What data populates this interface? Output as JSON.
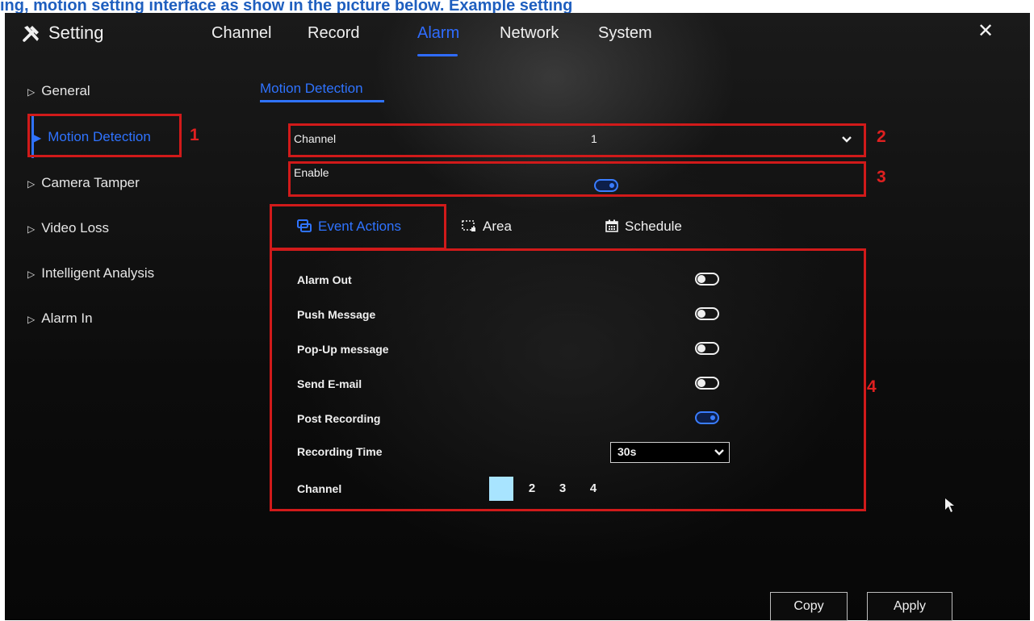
{
  "caption": {
    "part1": "ing, motion setting interface as show in the picture below. Example setting",
    "part2": "setting"
  },
  "app": {
    "title": "Setting",
    "title_icon": "tools-icon",
    "close_icon": "close-icon"
  },
  "topnav": [
    "Channel",
    "Record",
    "Alarm",
    "Network",
    "System"
  ],
  "topnav_active": "Alarm",
  "sidebar": {
    "items": [
      "General",
      "Motion Detection",
      "Camera Tamper",
      "Video Loss",
      "Intelligent Analysis",
      "Alarm In"
    ],
    "active": "Motion Detection"
  },
  "subtab": "Motion Detection",
  "channel_row": {
    "label": "Channel",
    "value": "1"
  },
  "enable_row": {
    "label": "Enable",
    "enabled": true
  },
  "tabs": [
    {
      "label": "Event Actions",
      "icon": "event-actions-icon"
    },
    {
      "label": "Area",
      "icon": "area-icon"
    },
    {
      "label": "Schedule",
      "icon": "calendar-icon"
    }
  ],
  "tabs_active": "Event Actions",
  "actions": [
    {
      "label": "Alarm Out",
      "enabled": false
    },
    {
      "label": "Push Message",
      "enabled": false
    },
    {
      "label": "Pop-Up message",
      "enabled": false
    },
    {
      "label": "Send E-mail",
      "enabled": false
    },
    {
      "label": "Post Recording",
      "enabled": true
    }
  ],
  "recording_time": {
    "label": "Recording Time",
    "value": "30s"
  },
  "channels": {
    "label": "Channel",
    "options": [
      "1",
      "2",
      "3",
      "4"
    ],
    "selected": "1"
  },
  "annotations": [
    "1",
    "2",
    "3",
    "4"
  ],
  "buttons": {
    "copy": "Copy",
    "apply": "Apply"
  },
  "colors": {
    "accent": "#2f73ff",
    "annotation": "#d11a1a",
    "background": "#0c0c0c"
  }
}
